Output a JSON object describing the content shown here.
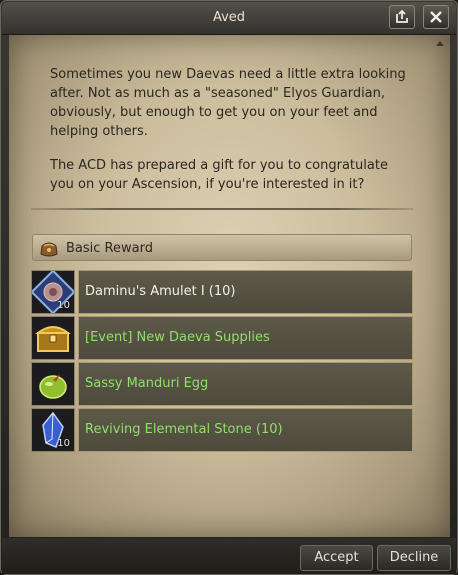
{
  "window": {
    "title": "Aved"
  },
  "title_buttons": {
    "restore_icon": "window-restore-icon",
    "close_icon": "close-icon"
  },
  "dialog": {
    "paragraphs": [
      "Sometimes you new Daevas need a little extra looking after. Not as much as a \"seasoned\" Elyos Guardian, obviously, but enough to get you on your feet and helping others.",
      "The ACD has prepared a gift for you to congratulate you on your Ascension, if you're interested in it?"
    ]
  },
  "rewards": {
    "header_label": "Basic Reward",
    "header_icon": "treasure-bag-icon",
    "items": [
      {
        "name": "Daminu's Amulet I (10)",
        "icon": "amulet-icon",
        "count": "10",
        "name_color": "#f2f0ea"
      },
      {
        "name": "[Event] New Daeva Supplies",
        "icon": "treasure-chest-icon",
        "count": "",
        "name_color": "#8fe06a"
      },
      {
        "name": "Sassy Manduri Egg",
        "icon": "egg-icon",
        "count": "",
        "name_color": "#8fe06a"
      },
      {
        "name": "Reviving Elemental Stone (10)",
        "icon": "crystal-icon",
        "count": "10",
        "name_color": "#8fe06a"
      }
    ]
  },
  "footer": {
    "accept_label": "Accept",
    "decline_label": "Decline"
  },
  "colors": {
    "parchment": "#cbbd9c",
    "item_green": "#8fe06a",
    "item_white": "#f2f0ea"
  }
}
